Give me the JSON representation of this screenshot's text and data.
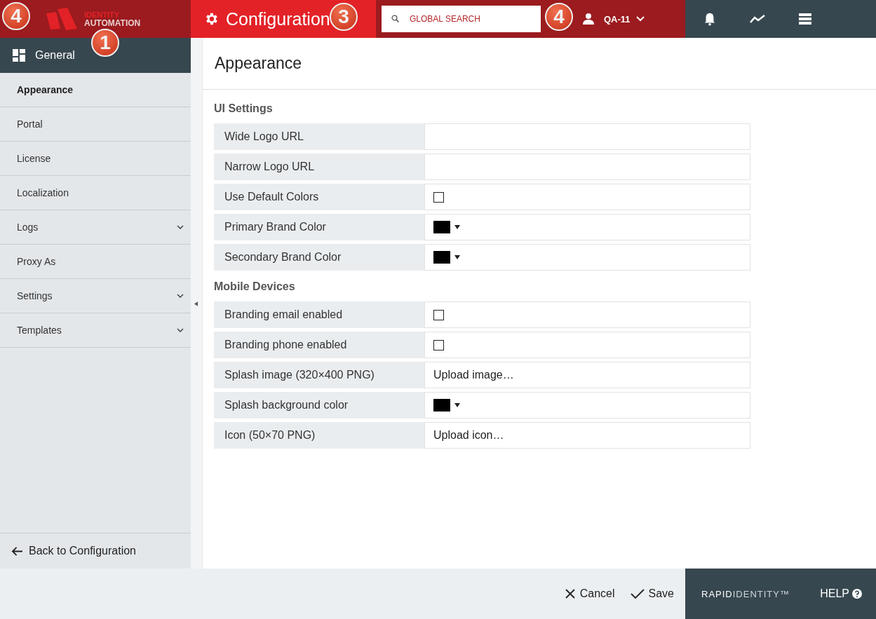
{
  "header": {
    "logo": {
      "line_1": "IDENTITY",
      "line_2": "AUTOMATION"
    },
    "module": {
      "label": "Configuration"
    },
    "search": {
      "placeholder": "GLOBAL SEARCH"
    },
    "user": {
      "name": "QA-11"
    }
  },
  "callouts": [
    {
      "number": "4"
    },
    {
      "number": "1"
    },
    {
      "number": "3"
    },
    {
      "number": "4"
    }
  ],
  "sidebar": {
    "title": "General",
    "items": [
      {
        "label": "Appearance",
        "selected": true
      },
      {
        "label": "Portal",
        "selected": false
      },
      {
        "label": "License",
        "selected": false
      },
      {
        "label": "Localization",
        "selected": false
      },
      {
        "label": "Logs",
        "selected": false,
        "expanded": false
      },
      {
        "label": "Proxy As",
        "selected": false
      },
      {
        "label": "Settings",
        "selected": false,
        "expanded": false
      },
      {
        "label": "Templates",
        "selected": false,
        "expanded": false
      }
    ],
    "back": "Back to Configuration"
  },
  "page": {
    "title": "Appearance",
    "sections": [
      {
        "title": "UI Settings",
        "rows": [
          {
            "label": "Wide Logo URL",
            "kind": "text"
          },
          {
            "label": "Narrow Logo URL",
            "kind": "text"
          },
          {
            "label": "Use Default Colors",
            "kind": "checkbox",
            "checked": false
          },
          {
            "label": "Primary Brand Color",
            "kind": "color",
            "color": "#000000"
          },
          {
            "label": "Secondary Brand Color",
            "kind": "color",
            "color": "#000000"
          }
        ]
      },
      {
        "title": "Mobile Devices",
        "rows": [
          {
            "label": "Branding email enabled",
            "kind": "checkbox",
            "checked": false
          },
          {
            "label": "Branding phone enabled",
            "kind": "checkbox",
            "checked": false
          },
          {
            "label": "Splash image (320×400 PNG)",
            "kind": "upload",
            "value": "Upload image…"
          },
          {
            "label": "Splash background color",
            "kind": "color",
            "color": "#000000"
          },
          {
            "label": "Icon (50×70 PNG)",
            "kind": "upload",
            "value": "Upload icon…"
          }
        ]
      }
    ]
  },
  "footer": {
    "cancel": "Cancel",
    "save": "Save",
    "brand": "**RAPID**IDENTITY™",
    "help": "HELP"
  }
}
